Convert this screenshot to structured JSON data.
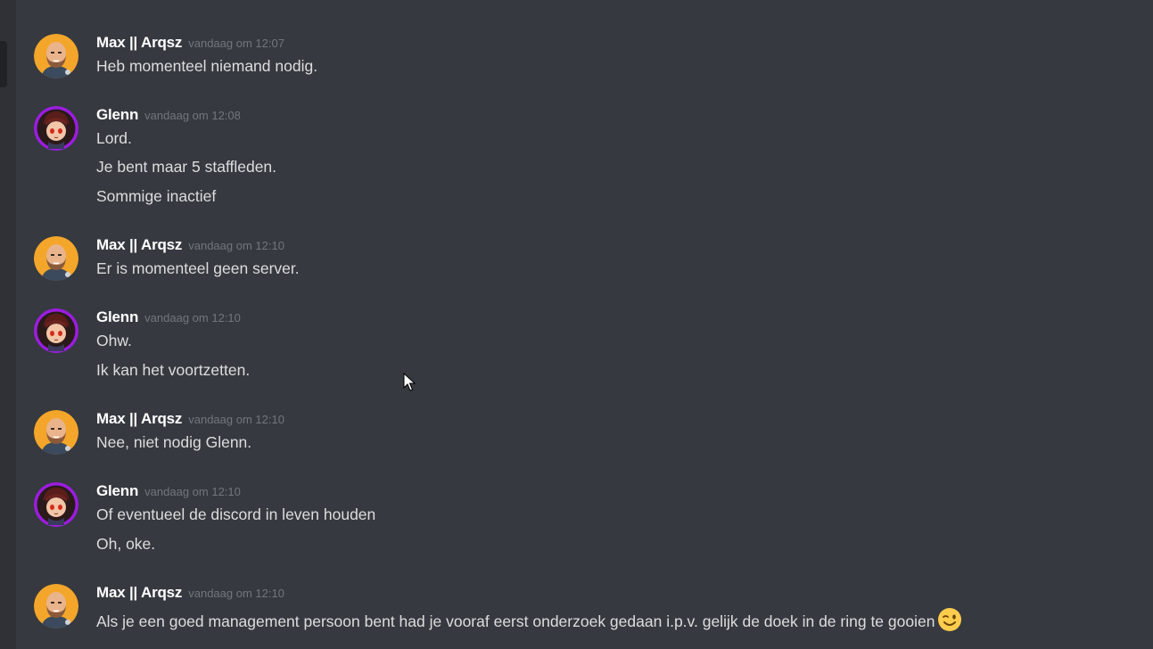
{
  "users": {
    "max": {
      "name": "Max || Arqsz"
    },
    "glenn": {
      "name": "Glenn"
    }
  },
  "messages": [
    {
      "user": "Max || Arqsz",
      "time": "vandaag om 12:07",
      "lines": [
        "Heb momenteel niemand nodig."
      ]
    },
    {
      "user": "Glenn",
      "time": "vandaag om 12:08",
      "lines": [
        "Lord.",
        "Je bent maar 5 staffleden.",
        "Sommige inactief"
      ]
    },
    {
      "user": "Max || Arqsz",
      "time": "vandaag om 12:10",
      "lines": [
        "Er is momenteel geen server."
      ]
    },
    {
      "user": "Glenn",
      "time": "vandaag om 12:10",
      "lines": [
        "Ohw.",
        "Ik kan het voortzetten."
      ]
    },
    {
      "user": "Max || Arqsz",
      "time": "vandaag om 12:10",
      "lines": [
        "Nee, niet nodig Glenn."
      ]
    },
    {
      "user": "Glenn",
      "time": "vandaag om 12:10",
      "lines": [
        "Of eventueel de discord in leven houden",
        "Oh, oke."
      ]
    },
    {
      "user": "Max || Arqsz",
      "time": "vandaag om 12:10",
      "lines": [
        "Als je een goed management persoon bent had je vooraf eerst onderzoek gedaan i.p.v. gelijk de doek in de ring te gooien"
      ],
      "emoji": "winking-face-emoji"
    }
  ],
  "colors": {
    "background": "#36393f",
    "username": "#ffffff",
    "timestamp": "#72767d",
    "text": "#dcddde",
    "glenn_ring": "#9b1de0",
    "max_avatar_bg": "#f4a62a"
  },
  "icons": {
    "cursor": "mouse-pointer-icon",
    "max_avatar": "bald-man-avatar",
    "glenn_avatar": "anime-character-avatar"
  }
}
